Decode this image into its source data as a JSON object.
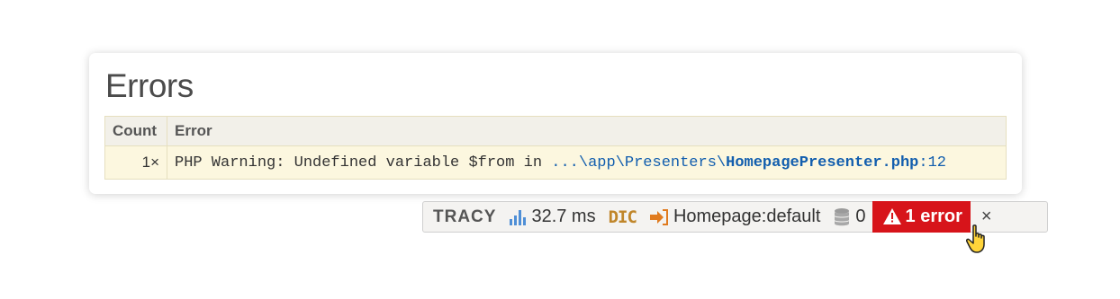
{
  "errors_panel": {
    "title": "Errors",
    "columns": [
      "Count",
      "Error"
    ],
    "rows": [
      {
        "count": "1×",
        "message": "PHP Warning: Undefined variable $from in ",
        "file_prefix": "...\\app\\Presenters\\",
        "file_name": "HomepagePresenter.php",
        "line": ":12"
      }
    ]
  },
  "tracy_bar": {
    "logo": "TRACY",
    "time": "32.7 ms",
    "dic_label": "DIC",
    "presenter": "Homepage:default",
    "queries": "0",
    "errors_label": "1 error",
    "close": "×"
  },
  "colors": {
    "error_red": "#d7141a",
    "link_blue": "#125eae",
    "row_bg": "#fcf7df",
    "header_bg": "#f2f0e9"
  },
  "icons": [
    "bar-chart-icon",
    "dic-icon",
    "sign-in-arrow-icon",
    "database-icon",
    "warning-triangle-icon",
    "close-icon",
    "hand-cursor-icon"
  ]
}
